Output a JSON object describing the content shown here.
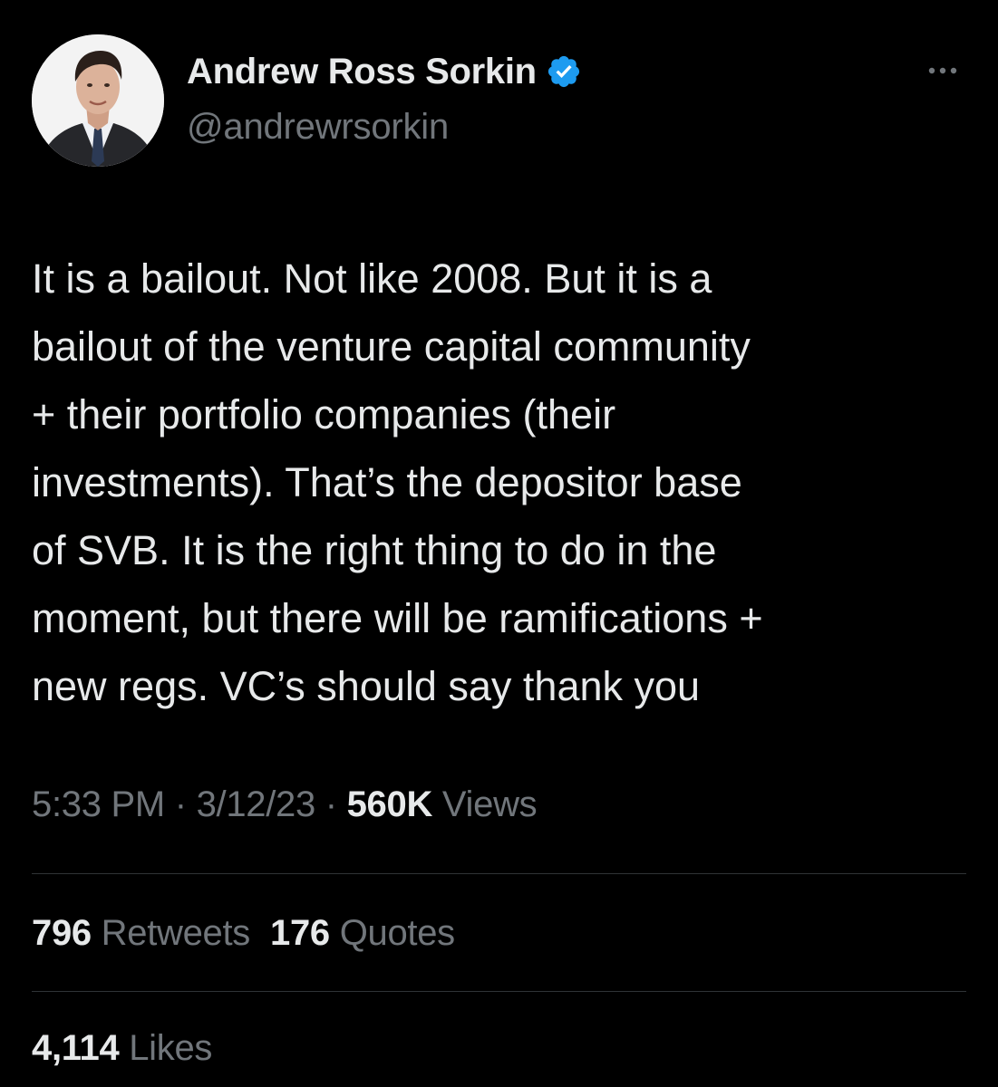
{
  "author": {
    "display_name": "Andrew Ross Sorkin",
    "handle": "@andrewrsorkin",
    "verified": true,
    "verified_color": "#1d9bf0",
    "avatar_icon": "profile-photo"
  },
  "more_icon": "ellipsis-icon",
  "tweet": {
    "lines": [
      "It is a bailout. Not like 2008. But it is a",
      "bailout of the venture capital community",
      "+ their portfolio companies (their",
      "investments). That’s the depositor base",
      "of SVB. It is the right thing to do in the",
      "moment, but there will be ramifications +",
      "new regs. VC’s should say thank you"
    ]
  },
  "meta": {
    "time": "5:33 PM",
    "separator": "·",
    "date": "3/12/23",
    "views_count": "560K",
    "views_label": "Views"
  },
  "stats": {
    "retweets_count": "796",
    "retweets_label": "Retweets",
    "quotes_count": "176",
    "quotes_label": "Quotes",
    "likes_count": "4,114",
    "likes_label": "Likes"
  },
  "colors": {
    "background": "#000000",
    "text_primary": "#e7e9ea",
    "text_secondary": "#71767b",
    "divider": "#2f3336"
  }
}
